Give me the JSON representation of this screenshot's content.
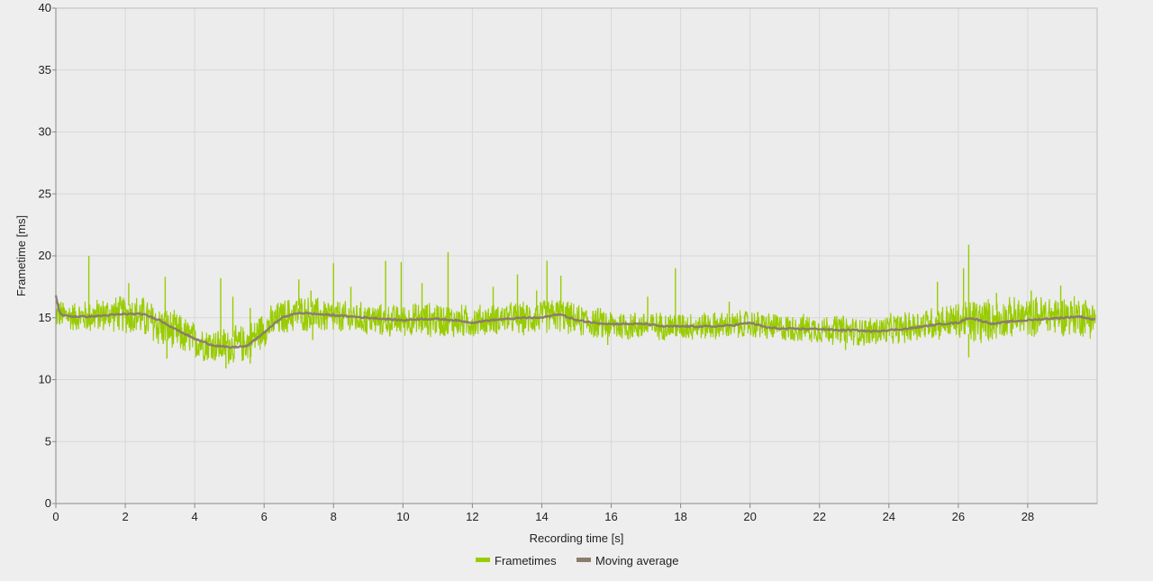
{
  "colors": {
    "background": "#eeeeee",
    "plot_background": "#ececec",
    "grid": "#d8d8d8",
    "axis": "#888888",
    "frametimes": "#99cc00",
    "moving_average": "#8b7d6b"
  },
  "chart_data": {
    "type": "line",
    "title": "",
    "xlabel": "Recording time [s]",
    "ylabel": "Frametime [ms]",
    "xlim": [
      0,
      30
    ],
    "ylim": [
      0,
      40
    ],
    "xticks": [
      0,
      2,
      4,
      6,
      8,
      10,
      12,
      14,
      16,
      18,
      20,
      22,
      24,
      26,
      28
    ],
    "yticks": [
      0,
      5,
      10,
      15,
      20,
      25,
      30,
      35,
      40
    ],
    "grid": true,
    "legend_position": "bottom-center",
    "series": [
      {
        "name": "Frametimes",
        "kind": "noisy-band",
        "x": [
          0,
          0.5,
          1,
          1.5,
          2,
          2.5,
          3,
          3.5,
          4,
          4.5,
          5,
          5.5,
          6,
          6.5,
          7,
          7.5,
          8,
          8.5,
          9,
          9.5,
          10,
          10.5,
          11,
          11.5,
          12,
          12.5,
          13,
          13.5,
          14,
          14.5,
          15,
          15.5,
          16,
          16.5,
          17,
          17.5,
          18,
          18.5,
          19,
          19.5,
          20,
          20.5,
          21,
          21.5,
          22,
          22.5,
          23,
          23.5,
          24,
          24.5,
          25,
          25.5,
          26,
          26.5,
          27,
          27.5,
          28,
          28.5,
          29,
          29.5,
          30
        ],
        "low": [
          14.0,
          13.8,
          13.6,
          13.8,
          13.6,
          13.2,
          12.4,
          12.0,
          11.5,
          11.2,
          11.0,
          11.3,
          12.5,
          13.4,
          13.8,
          13.6,
          13.5,
          13.5,
          13.4,
          13.3,
          13.4,
          13.3,
          13.3,
          13.2,
          13.2,
          13.5,
          13.6,
          13.4,
          13.6,
          13.7,
          13.4,
          13.2,
          13.0,
          13.0,
          13.1,
          13.1,
          13.0,
          13.1,
          13.1,
          13.1,
          13.2,
          13.0,
          12.9,
          12.9,
          12.8,
          12.7,
          12.6,
          12.5,
          12.7,
          12.8,
          13.0,
          13.1,
          13.1,
          12.4,
          13.0,
          13.2,
          13.3,
          13.4,
          13.4,
          13.3,
          13.2
        ],
        "high": [
          16.6,
          16.4,
          16.6,
          16.8,
          17.0,
          17.0,
          16.2,
          15.6,
          14.8,
          14.4,
          14.4,
          14.6,
          15.8,
          16.6,
          17.0,
          16.8,
          16.6,
          16.4,
          16.4,
          16.2,
          16.2,
          16.4,
          16.4,
          16.2,
          16.2,
          16.2,
          16.4,
          16.4,
          16.6,
          16.8,
          16.2,
          16.0,
          15.8,
          15.7,
          15.6,
          15.6,
          15.6,
          15.6,
          15.6,
          15.6,
          15.8,
          15.6,
          15.4,
          15.4,
          15.4,
          15.4,
          15.2,
          15.2,
          15.4,
          15.6,
          16.0,
          16.2,
          16.4,
          17.0,
          16.6,
          16.8,
          16.8,
          17.0,
          17.0,
          17.0,
          16.8
        ],
        "spikes": [
          [
            0.95,
            20.0
          ],
          [
            2.1,
            17.8
          ],
          [
            3.15,
            18.3
          ],
          [
            4.75,
            18.2
          ],
          [
            5.1,
            16.7
          ],
          [
            5.6,
            15.8
          ],
          [
            7.0,
            18.1
          ],
          [
            7.35,
            17.2
          ],
          [
            8.0,
            19.4
          ],
          [
            8.5,
            17.5
          ],
          [
            9.5,
            19.6
          ],
          [
            9.95,
            19.5
          ],
          [
            10.55,
            17.8
          ],
          [
            11.3,
            20.3
          ],
          [
            12.6,
            17.5
          ],
          [
            13.3,
            18.5
          ],
          [
            13.85,
            17.2
          ],
          [
            14.15,
            19.6
          ],
          [
            14.55,
            18.4
          ],
          [
            17.05,
            16.7
          ],
          [
            17.85,
            19.0
          ],
          [
            19.4,
            16.3
          ],
          [
            25.4,
            17.9
          ],
          [
            26.15,
            19.0
          ],
          [
            26.3,
            20.9
          ],
          [
            27.1,
            17.0
          ],
          [
            28.1,
            17.2
          ],
          [
            28.95,
            17.6
          ]
        ],
        "dips": [
          [
            3.2,
            11.7
          ],
          [
            4.9,
            10.9
          ],
          [
            5.6,
            11.3
          ],
          [
            26.3,
            11.8
          ],
          [
            7.4,
            13.2
          ],
          [
            15.9,
            12.8
          ],
          [
            22.75,
            12.4
          ]
        ]
      },
      {
        "name": "Moving average",
        "kind": "line",
        "x": [
          0,
          0.1,
          0.2,
          0.5,
          1,
          1.5,
          2,
          2.5,
          3,
          3.5,
          4,
          4.5,
          5,
          5.5,
          6,
          6.5,
          7,
          7.5,
          8,
          8.5,
          9,
          9.5,
          10,
          10.5,
          11,
          11.5,
          12,
          12.5,
          13,
          13.5,
          14,
          14.5,
          15,
          15.5,
          16,
          16.5,
          17,
          17.5,
          18,
          18.5,
          19,
          19.5,
          20,
          20.5,
          21,
          21.5,
          22,
          22.5,
          23,
          23.5,
          24,
          24.5,
          25,
          25.5,
          26,
          26.3,
          26.6,
          27,
          27.5,
          28,
          28.5,
          29,
          29.5,
          30
        ],
        "y": [
          16.8,
          15.5,
          15.2,
          15.1,
          15.1,
          15.2,
          15.3,
          15.3,
          14.8,
          14.0,
          13.3,
          12.8,
          12.6,
          12.7,
          13.8,
          15.0,
          15.4,
          15.3,
          15.2,
          15.1,
          15.0,
          14.9,
          14.8,
          14.9,
          14.9,
          14.8,
          14.6,
          14.8,
          14.9,
          15.0,
          15.0,
          15.3,
          14.8,
          14.6,
          14.5,
          14.5,
          14.5,
          14.3,
          14.3,
          14.3,
          14.3,
          14.4,
          14.6,
          14.2,
          14.1,
          14.1,
          14.1,
          14.0,
          14.0,
          13.9,
          14.0,
          14.1,
          14.3,
          14.5,
          14.6,
          15.0,
          14.8,
          14.5,
          14.7,
          14.8,
          14.9,
          15.0,
          15.1,
          14.8
        ]
      }
    ]
  }
}
